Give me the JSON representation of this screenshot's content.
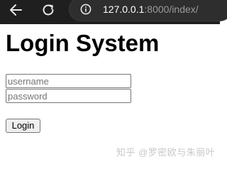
{
  "browser": {
    "back_icon": "arrow-left-icon",
    "reload_icon": "reload-icon",
    "site_info_icon": "info-circle-icon",
    "url_host": "127.0.0.1",
    "url_rest": ":8000/index/"
  },
  "page": {
    "title": "Login System",
    "username_placeholder": "username",
    "password_placeholder": "password",
    "login_label": "Login"
  },
  "watermark": {
    "text": "知乎 @罗密欧与朱丽叶"
  },
  "colors": {
    "toolbar_background": "#1f1f1f",
    "page_background": "#ffffff",
    "title_text": "#000000"
  }
}
